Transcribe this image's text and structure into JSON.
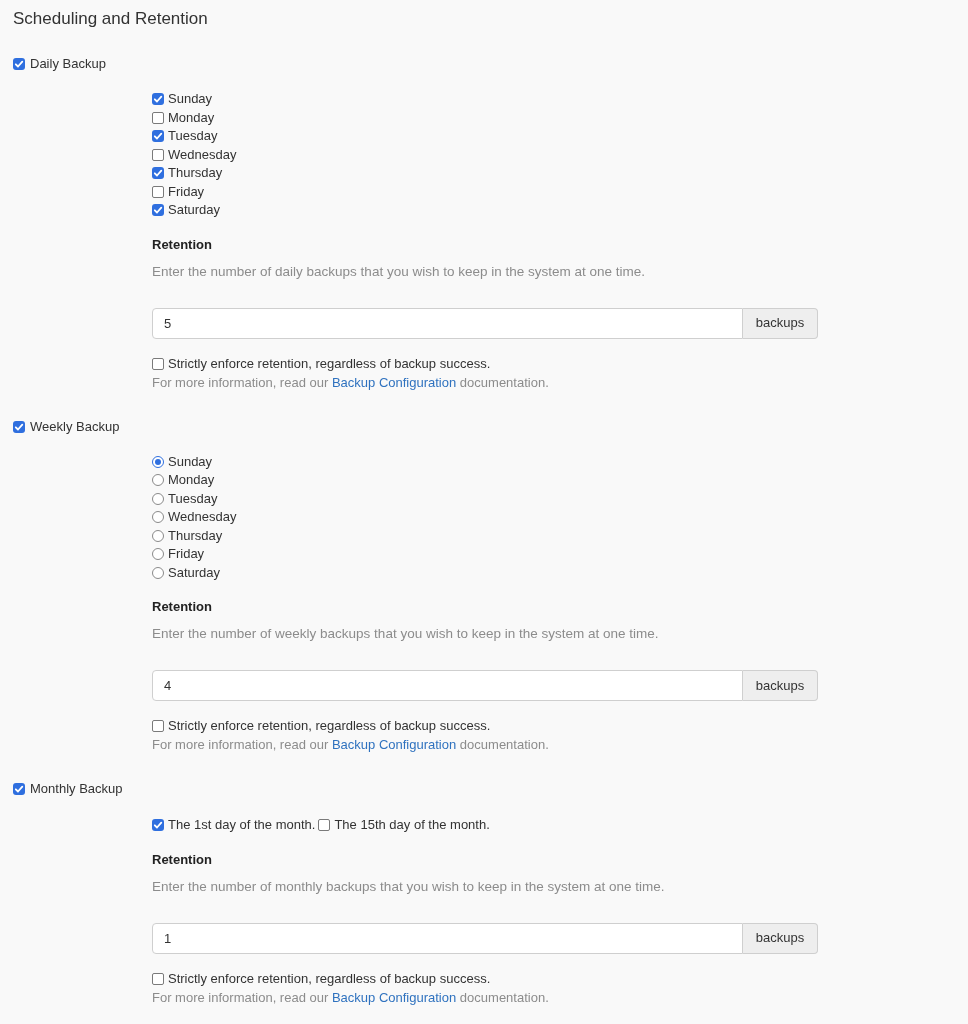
{
  "title": "Scheduling and Retention",
  "sections": [
    {
      "label": "Daily Backup",
      "checked": true,
      "options": {
        "kind": "stacked",
        "items": [
          {
            "kind": "checkbox",
            "label": "Sunday",
            "checked": true
          },
          {
            "kind": "checkbox",
            "label": "Monday",
            "checked": false
          },
          {
            "kind": "checkbox",
            "label": "Tuesday",
            "checked": true
          },
          {
            "kind": "checkbox",
            "label": "Wednesday",
            "checked": false
          },
          {
            "kind": "checkbox",
            "label": "Thursday",
            "checked": true
          },
          {
            "kind": "checkbox",
            "label": "Friday",
            "checked": false
          },
          {
            "kind": "checkbox",
            "label": "Saturday",
            "checked": true
          }
        ]
      },
      "retention": {
        "heading": "Retention",
        "help": "Enter the number of daily backups that you wish to keep in the system at one time.",
        "value": "5",
        "addon": "backups"
      },
      "strict": {
        "label": "Strictly enforce retention, regardless of backup success.",
        "checked": false
      },
      "info": {
        "before": "For more information, read our",
        "link": "Backup Configuration",
        "after": "documentation."
      }
    },
    {
      "label": "Weekly Backup",
      "checked": true,
      "options": {
        "kind": "stacked",
        "items": [
          {
            "kind": "radio",
            "label": "Sunday",
            "selected": true
          },
          {
            "kind": "radio",
            "label": "Monday",
            "selected": false
          },
          {
            "kind": "radio",
            "label": "Tuesday",
            "selected": false
          },
          {
            "kind": "radio",
            "label": "Wednesday",
            "selected": false
          },
          {
            "kind": "radio",
            "label": "Thursday",
            "selected": false
          },
          {
            "kind": "radio",
            "label": "Friday",
            "selected": false
          },
          {
            "kind": "radio",
            "label": "Saturday",
            "selected": false
          }
        ]
      },
      "retention": {
        "heading": "Retention",
        "help": "Enter the number of weekly backups that you wish to keep in the system at one time.",
        "value": "4",
        "addon": "backups"
      },
      "strict": {
        "label": "Strictly enforce retention, regardless of backup success.",
        "checked": false
      },
      "info": {
        "before": "For more information, read our",
        "link": "Backup Configuration",
        "after": "documentation."
      }
    },
    {
      "label": "Monthly Backup",
      "checked": true,
      "options": {
        "kind": "inline",
        "items": [
          {
            "kind": "checkbox",
            "label": "The 1st day of the month.",
            "checked": true
          },
          {
            "kind": "checkbox",
            "label": "The 15th day of the month.",
            "checked": false
          }
        ]
      },
      "retention": {
        "heading": "Retention",
        "help": "Enter the number of monthly backups that you wish to keep in the system at one time.",
        "value": "1",
        "addon": "backups"
      },
      "strict": {
        "label": "Strictly enforce retention, regardless of backup success.",
        "checked": false
      },
      "info": {
        "before": "For more information, read our",
        "link": "Backup Configuration",
        "after": "documentation."
      }
    }
  ]
}
